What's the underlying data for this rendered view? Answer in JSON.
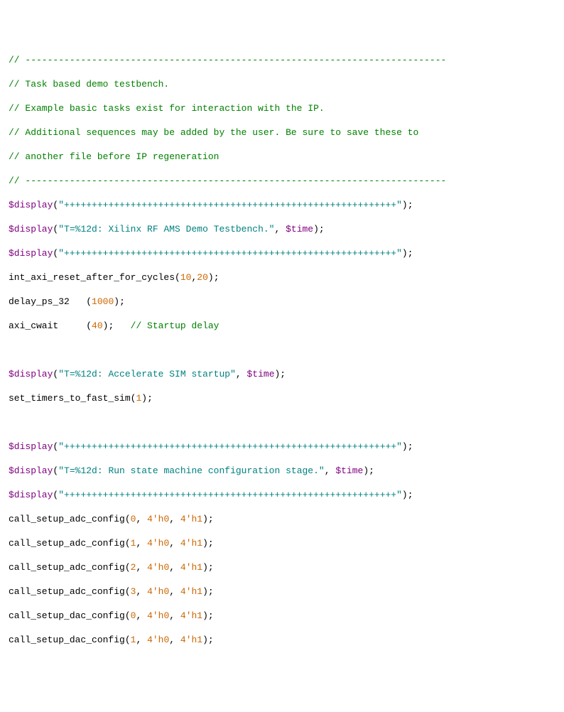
{
  "comments": {
    "dash1": "// ----------------------------------------------------------------------------",
    "l1": "// Task based demo testbench.",
    "l2": "// Example basic tasks exist for interaction with the IP.",
    "l3": "// Additional sequences may be added by the user. Be sure to save these to",
    "l4": "// another file before IP regeneration",
    "dash2": "// ----------------------------------------------------------------------------",
    "startup": "// Startup delay"
  },
  "kw": {
    "display": "$display",
    "time": "$time"
  },
  "str": {
    "plusline": "\"++++++++++++++++++++++++++++++++++++++++++++++++++++++++++++\"",
    "tb_title": "\"T=%12d: Xilinx RF AMS Demo Testbench.\"",
    "accel": "\"T=%12d: Accelerate SIM startup\"",
    "runsm": "\"T=%12d: Run state machine configuration stage.\""
  },
  "fn": {
    "reset": "int_axi_reset_after_for_cycles",
    "delay": "delay_ps_32",
    "cwait": "axi_cwait",
    "timers": "set_timers_to_fast_sim",
    "adc": "call_setup_adc_config",
    "dac": "call_setup_dac_config"
  },
  "num": {
    "ten": "10",
    "twenty": "20",
    "thousand": "1000",
    "forty": "40",
    "one": "1",
    "zero": "0",
    "two": "2",
    "three": "3",
    "h0": "4'h0",
    "h1": "4'h1"
  }
}
